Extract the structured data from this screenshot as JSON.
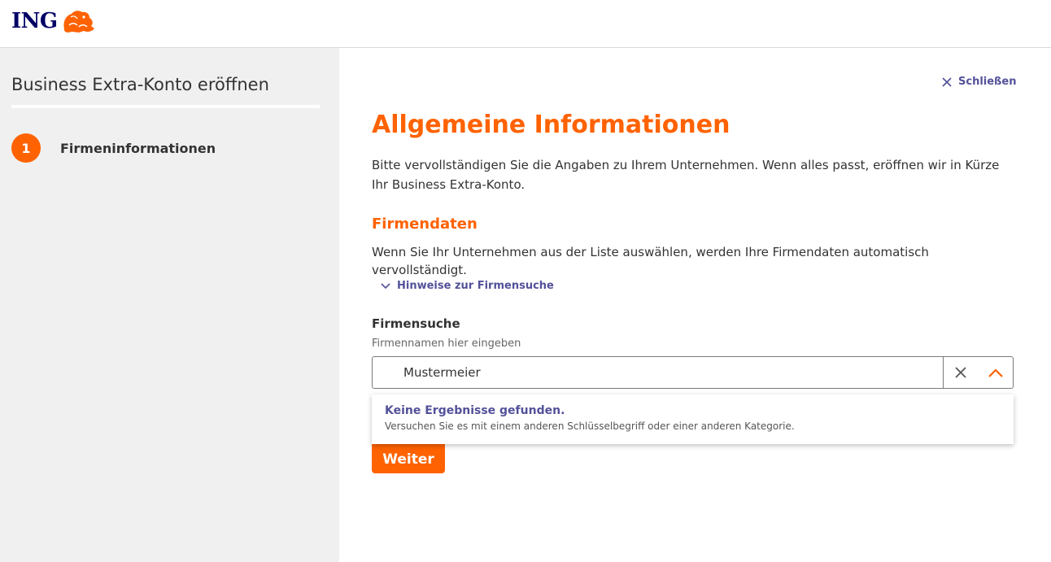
{
  "brand": {
    "name": "ING",
    "color_primary": "#ff6200",
    "color_navy": "#000066",
    "color_link": "#525199"
  },
  "sidebar": {
    "title": "Business Extra-Konto eröffnen",
    "steps": [
      {
        "number": "1",
        "label": "Firmeninformationen"
      }
    ]
  },
  "close": {
    "label": "Schließen",
    "icon": "close-icon"
  },
  "main": {
    "title": "Allgemeine Informationen",
    "intro": "Bitte vervollständigen Sie die Angaben zu Ihrem Unternehmen. Wenn alles passt, eröffnen wir in Kürze Ihr Business Extra-Konto."
  },
  "company": {
    "section_title": "Firmendaten",
    "section_text": "Wenn Sie Ihr Unternehmen aus der Liste auswählen, werden Ihre Firmendaten automatisch vervollständigt.",
    "hint_label": "Hinweise zur Firmensuche",
    "search_label": "Firmensuche",
    "search_help": "Firmennamen hier eingeben",
    "search_value": "Mustermeier",
    "dropdown_title": "Keine Ergebnisse gefunden.",
    "dropdown_text": "Versuchen Sie es mit einem anderen Schlüsselbegriff oder einer anderen Kategorie."
  },
  "actions": {
    "next_label": "Weiter"
  }
}
